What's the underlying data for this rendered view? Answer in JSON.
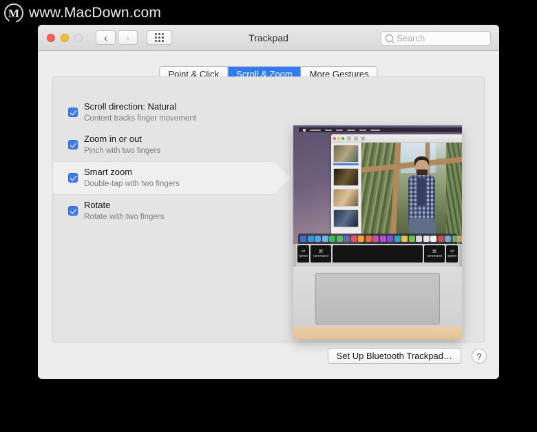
{
  "watermark": {
    "logo_letter": "M",
    "text": "www.MacDown.com"
  },
  "window": {
    "title": "Trackpad",
    "traffic_lights": [
      "close",
      "minimize",
      "zoom-disabled"
    ],
    "nav": {
      "back": "‹",
      "forward": "›",
      "grid": "show-all-grid"
    },
    "search": {
      "placeholder": "Search",
      "value": ""
    }
  },
  "tabs": [
    {
      "label": "Point & Click",
      "active": false
    },
    {
      "label": "Scroll & Zoom",
      "active": true
    },
    {
      "label": "More Gestures",
      "active": false
    }
  ],
  "options": [
    {
      "title": "Scroll direction: Natural",
      "subtitle": "Content tracks finger movement",
      "checked": true,
      "selected": false
    },
    {
      "title": "Zoom in or out",
      "subtitle": "Pinch with two fingers",
      "checked": true,
      "selected": false
    },
    {
      "title": "Smart zoom",
      "subtitle": "Double-tap with two fingers",
      "checked": true,
      "selected": true
    },
    {
      "title": "Rotate",
      "subtitle": "Rotate with two fingers",
      "checked": true,
      "selected": false
    }
  ],
  "preview": {
    "description": "MacBook demonstration video of smart zoom gesture",
    "keys": [
      {
        "sub": "alt",
        "label": "option"
      },
      {
        "glyph": "⌘",
        "label": "command"
      },
      {
        "glyph": "",
        "label": ""
      },
      {
        "glyph": "⌘",
        "label": "command"
      },
      {
        "sub": "alt",
        "label": "option"
      }
    ],
    "dock_colors": [
      "#3b6fd4",
      "#2f9ae0",
      "#49a7e8",
      "#6fb0e8",
      "#3fba5a",
      "#4dbf68",
      "#5f6bb8",
      "#e0516b",
      "#f0a33c",
      "#ef6a3a",
      "#cf4f9e",
      "#b14fd0",
      "#7b54d8",
      "#2fa7c4",
      "#e8c53c",
      "#6cc24a",
      "#d8d8d8",
      "#e6e6e6",
      "#f2f2f2",
      "#c64b4b",
      "#7ea5d8",
      "#58b36b",
      "#e57ab0",
      "#45a0c8",
      "#9a9a9a",
      "#cfcfcf"
    ]
  },
  "footer": {
    "setup_button": "Set Up Bluetooth Trackpad…",
    "help_button": "?"
  },
  "colors": {
    "accent_blue": "#2f7cf6",
    "checkbox_blue": "#3d7ef4",
    "window_bg": "#ececec",
    "panel_bg": "#e4e4e4"
  }
}
